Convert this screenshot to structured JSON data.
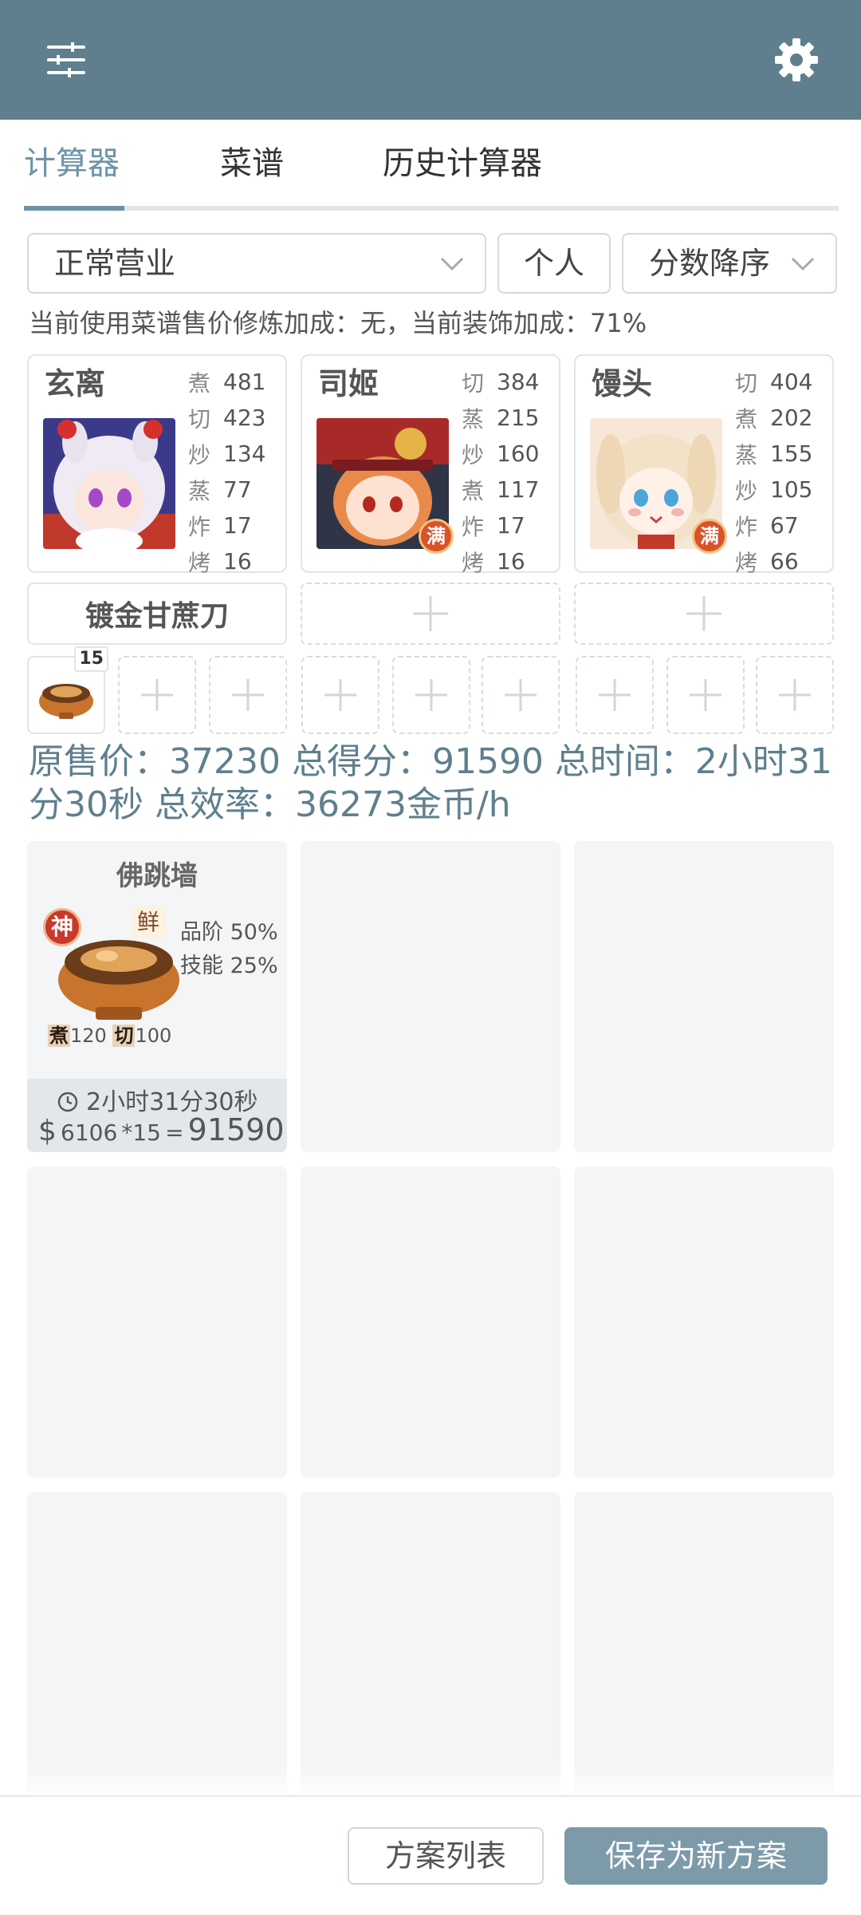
{
  "appbar": {
    "left_icon": "sliders-icon",
    "right_icon": "gear-icon"
  },
  "tabs": [
    {
      "label": "计算器",
      "active": true
    },
    {
      "label": "菜谱",
      "active": false
    },
    {
      "label": "历史计算器",
      "active": false
    }
  ],
  "filters": {
    "mode": "正常营业",
    "scope": "个人",
    "sort": "分数降序"
  },
  "note": "当前使用菜谱售价修炼加成：无，当前装饰加成：71%",
  "chefs": [
    {
      "name": "玄离",
      "full_badge": "",
      "stats": [
        {
          "label": "煮",
          "value": "481"
        },
        {
          "label": "切",
          "value": "423"
        },
        {
          "label": "炒",
          "value": "134"
        },
        {
          "label": "蒸",
          "value": "77"
        },
        {
          "label": "炸",
          "value": "17"
        },
        {
          "label": "烤",
          "value": "16"
        }
      ]
    },
    {
      "name": "司姬",
      "full_badge": "满",
      "stats": [
        {
          "label": "切",
          "value": "384"
        },
        {
          "label": "蒸",
          "value": "215"
        },
        {
          "label": "炒",
          "value": "160"
        },
        {
          "label": "煮",
          "value": "117"
        },
        {
          "label": "炸",
          "value": "17"
        },
        {
          "label": "烤",
          "value": "16"
        }
      ]
    },
    {
      "name": "馒头",
      "full_badge": "满",
      "stats": [
        {
          "label": "切",
          "value": "404"
        },
        {
          "label": "煮",
          "value": "202"
        },
        {
          "label": "蒸",
          "value": "155"
        },
        {
          "label": "炒",
          "value": "105"
        },
        {
          "label": "炸",
          "value": "67"
        },
        {
          "label": "烤",
          "value": "66"
        }
      ]
    }
  ],
  "equips": [
    {
      "name": "镀金甘蔗刀"
    }
  ],
  "recipe_slots": {
    "first_count": "15"
  },
  "summary": "原售价：37230 总得分：91590 总时间：2小时31分30秒 总效率：36273金币/h",
  "dish": {
    "name": "佛跳墙",
    "rarity_tag": "神",
    "flavor_tag": "鲜",
    "grade_label": "品阶",
    "grade_pct": "50%",
    "skill_label": "技能",
    "skill_pct": "25%",
    "req1_label": "煮",
    "req1_val": "120",
    "req2_label": "切",
    "req2_val": "100",
    "time": "2小时31分30秒",
    "currency": "$",
    "price": "6106",
    "mult": "*15",
    "eq": "=",
    "total": "91590"
  },
  "buttons": {
    "list": "方案列表",
    "save": "保存为新方案"
  },
  "colors": {
    "header": "#5f7f8e",
    "accent": "#6d93a6",
    "primary_button": "#7d9aa9"
  }
}
